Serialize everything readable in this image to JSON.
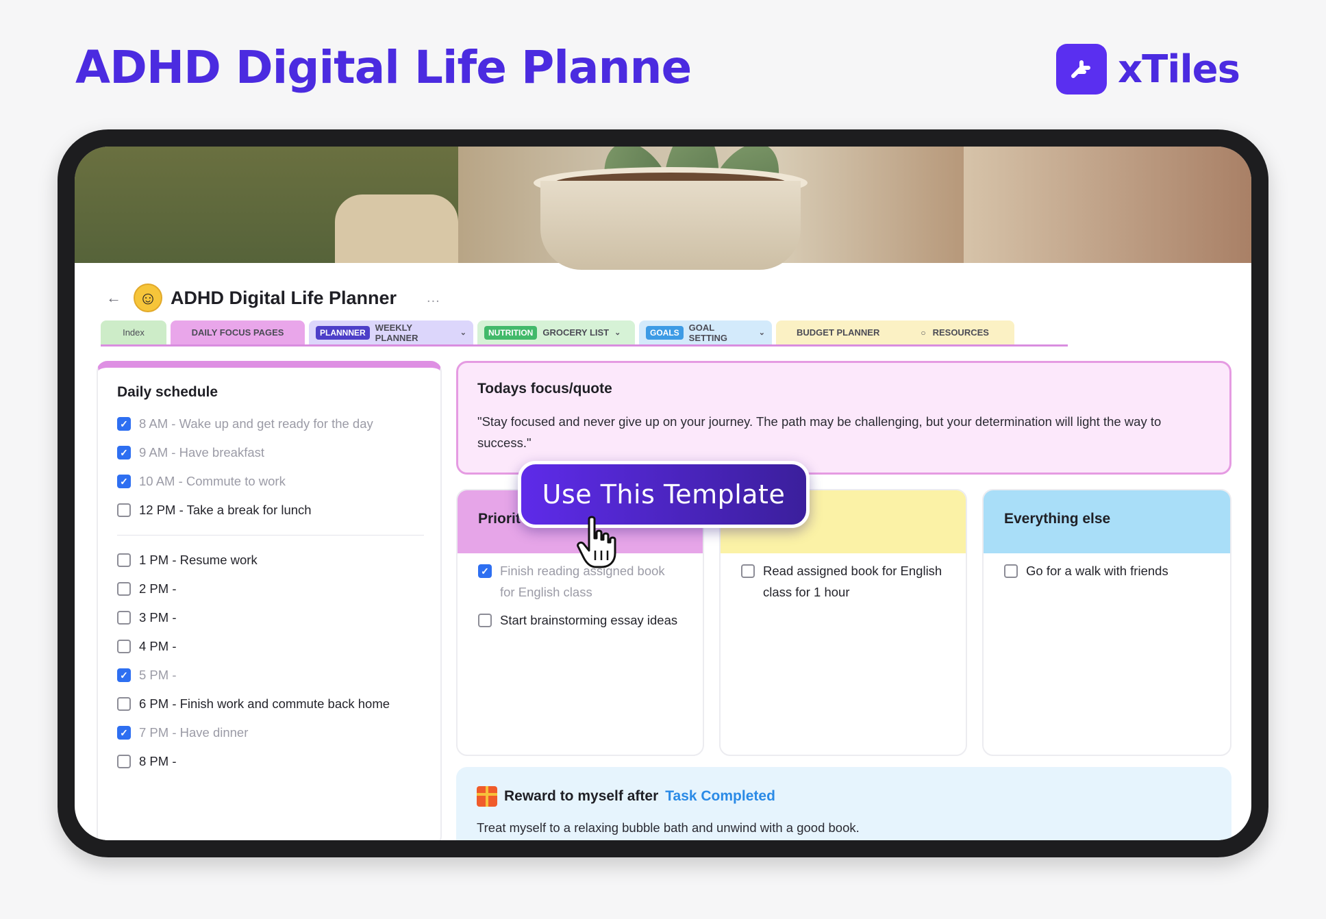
{
  "page": {
    "headline": "ADHD Digital Life Planne",
    "brand_name": "xTiles",
    "cta_label": "Use This Template"
  },
  "doc": {
    "back_icon": "back-arrow-icon",
    "title": "ADHD Digital Life Planner",
    "more": "...",
    "tabs": [
      {
        "label": "Index",
        "bg": "#cdecc8"
      },
      {
        "label": "DAILY FOCUS PAGES",
        "bg": "#e9a6ea"
      },
      {
        "badge": "PLANNNER",
        "badge_color": "#4d3fc8",
        "label": "WEEKLY PLANNER",
        "bg": "#dcd6fb"
      },
      {
        "badge": "NUTRITION",
        "badge_color": "#42b96a",
        "label": "GROCERY LIST",
        "bg": "#d6f2d6"
      },
      {
        "badge": "GOALS",
        "badge_color": "#3d9be5",
        "label": "GOAL SETTING",
        "bg": "#d3eafb"
      },
      {
        "label": "BUDGET PLANNER",
        "bg": "#fbf1c4"
      },
      {
        "label": "RESOURCES",
        "bg": "#fbf1c4"
      }
    ]
  },
  "schedule": {
    "title": "Daily schedule",
    "group1": [
      {
        "text": "8 AM -  Wake up and get ready for the day",
        "checked": true
      },
      {
        "text": "9 AM - Have breakfast",
        "checked": true
      },
      {
        "text": "10 AM - Commute to work",
        "checked": true
      },
      {
        "text": "12 PM - Take a break for lunch",
        "checked": false
      }
    ],
    "group2": [
      {
        "text": "1 PM - Resume work",
        "checked": false
      },
      {
        "text": "2 PM -",
        "checked": false
      },
      {
        "text": "3 PM -",
        "checked": false
      },
      {
        "text": "4 PM -",
        "checked": false
      },
      {
        "text": "5 PM -",
        "checked": true
      },
      {
        "text": "6 PM - Finish work and commute back home",
        "checked": false
      },
      {
        "text": "7 PM - Have dinner",
        "checked": true
      },
      {
        "text": "8 PM -",
        "checked": false
      }
    ]
  },
  "focus": {
    "title": "Todays focus/quote",
    "quote": "\"Stay focused and never give up on your journey. The path may be challenging, but your determination will light the way to success.\""
  },
  "columns": [
    {
      "title": "Priorit",
      "header_color": "#e6a5e8",
      "items": [
        {
          "text": "Finish reading assigned book for English class",
          "checked": true
        },
        {
          "text": "Start brainstorming essay ideas",
          "checked": false
        }
      ]
    },
    {
      "title": "",
      "header_color": "#fbf2a6",
      "items": [
        {
          "text": "Read assigned book for English class for 1 hour",
          "checked": false
        }
      ]
    },
    {
      "title": "Everything else",
      "header_color": "#a9def8",
      "items": [
        {
          "text": "Go for a walk with friends",
          "checked": false
        }
      ]
    }
  ],
  "reward": {
    "icon": "gift-icon",
    "title_prefix": "Reward to myself after",
    "title_link": "Task Completed",
    "body": "Treat myself to a relaxing bubble bath and unwind with a good book."
  },
  "colors": {
    "accent": "#4b2be0",
    "check_blue": "#2e6ff1"
  }
}
